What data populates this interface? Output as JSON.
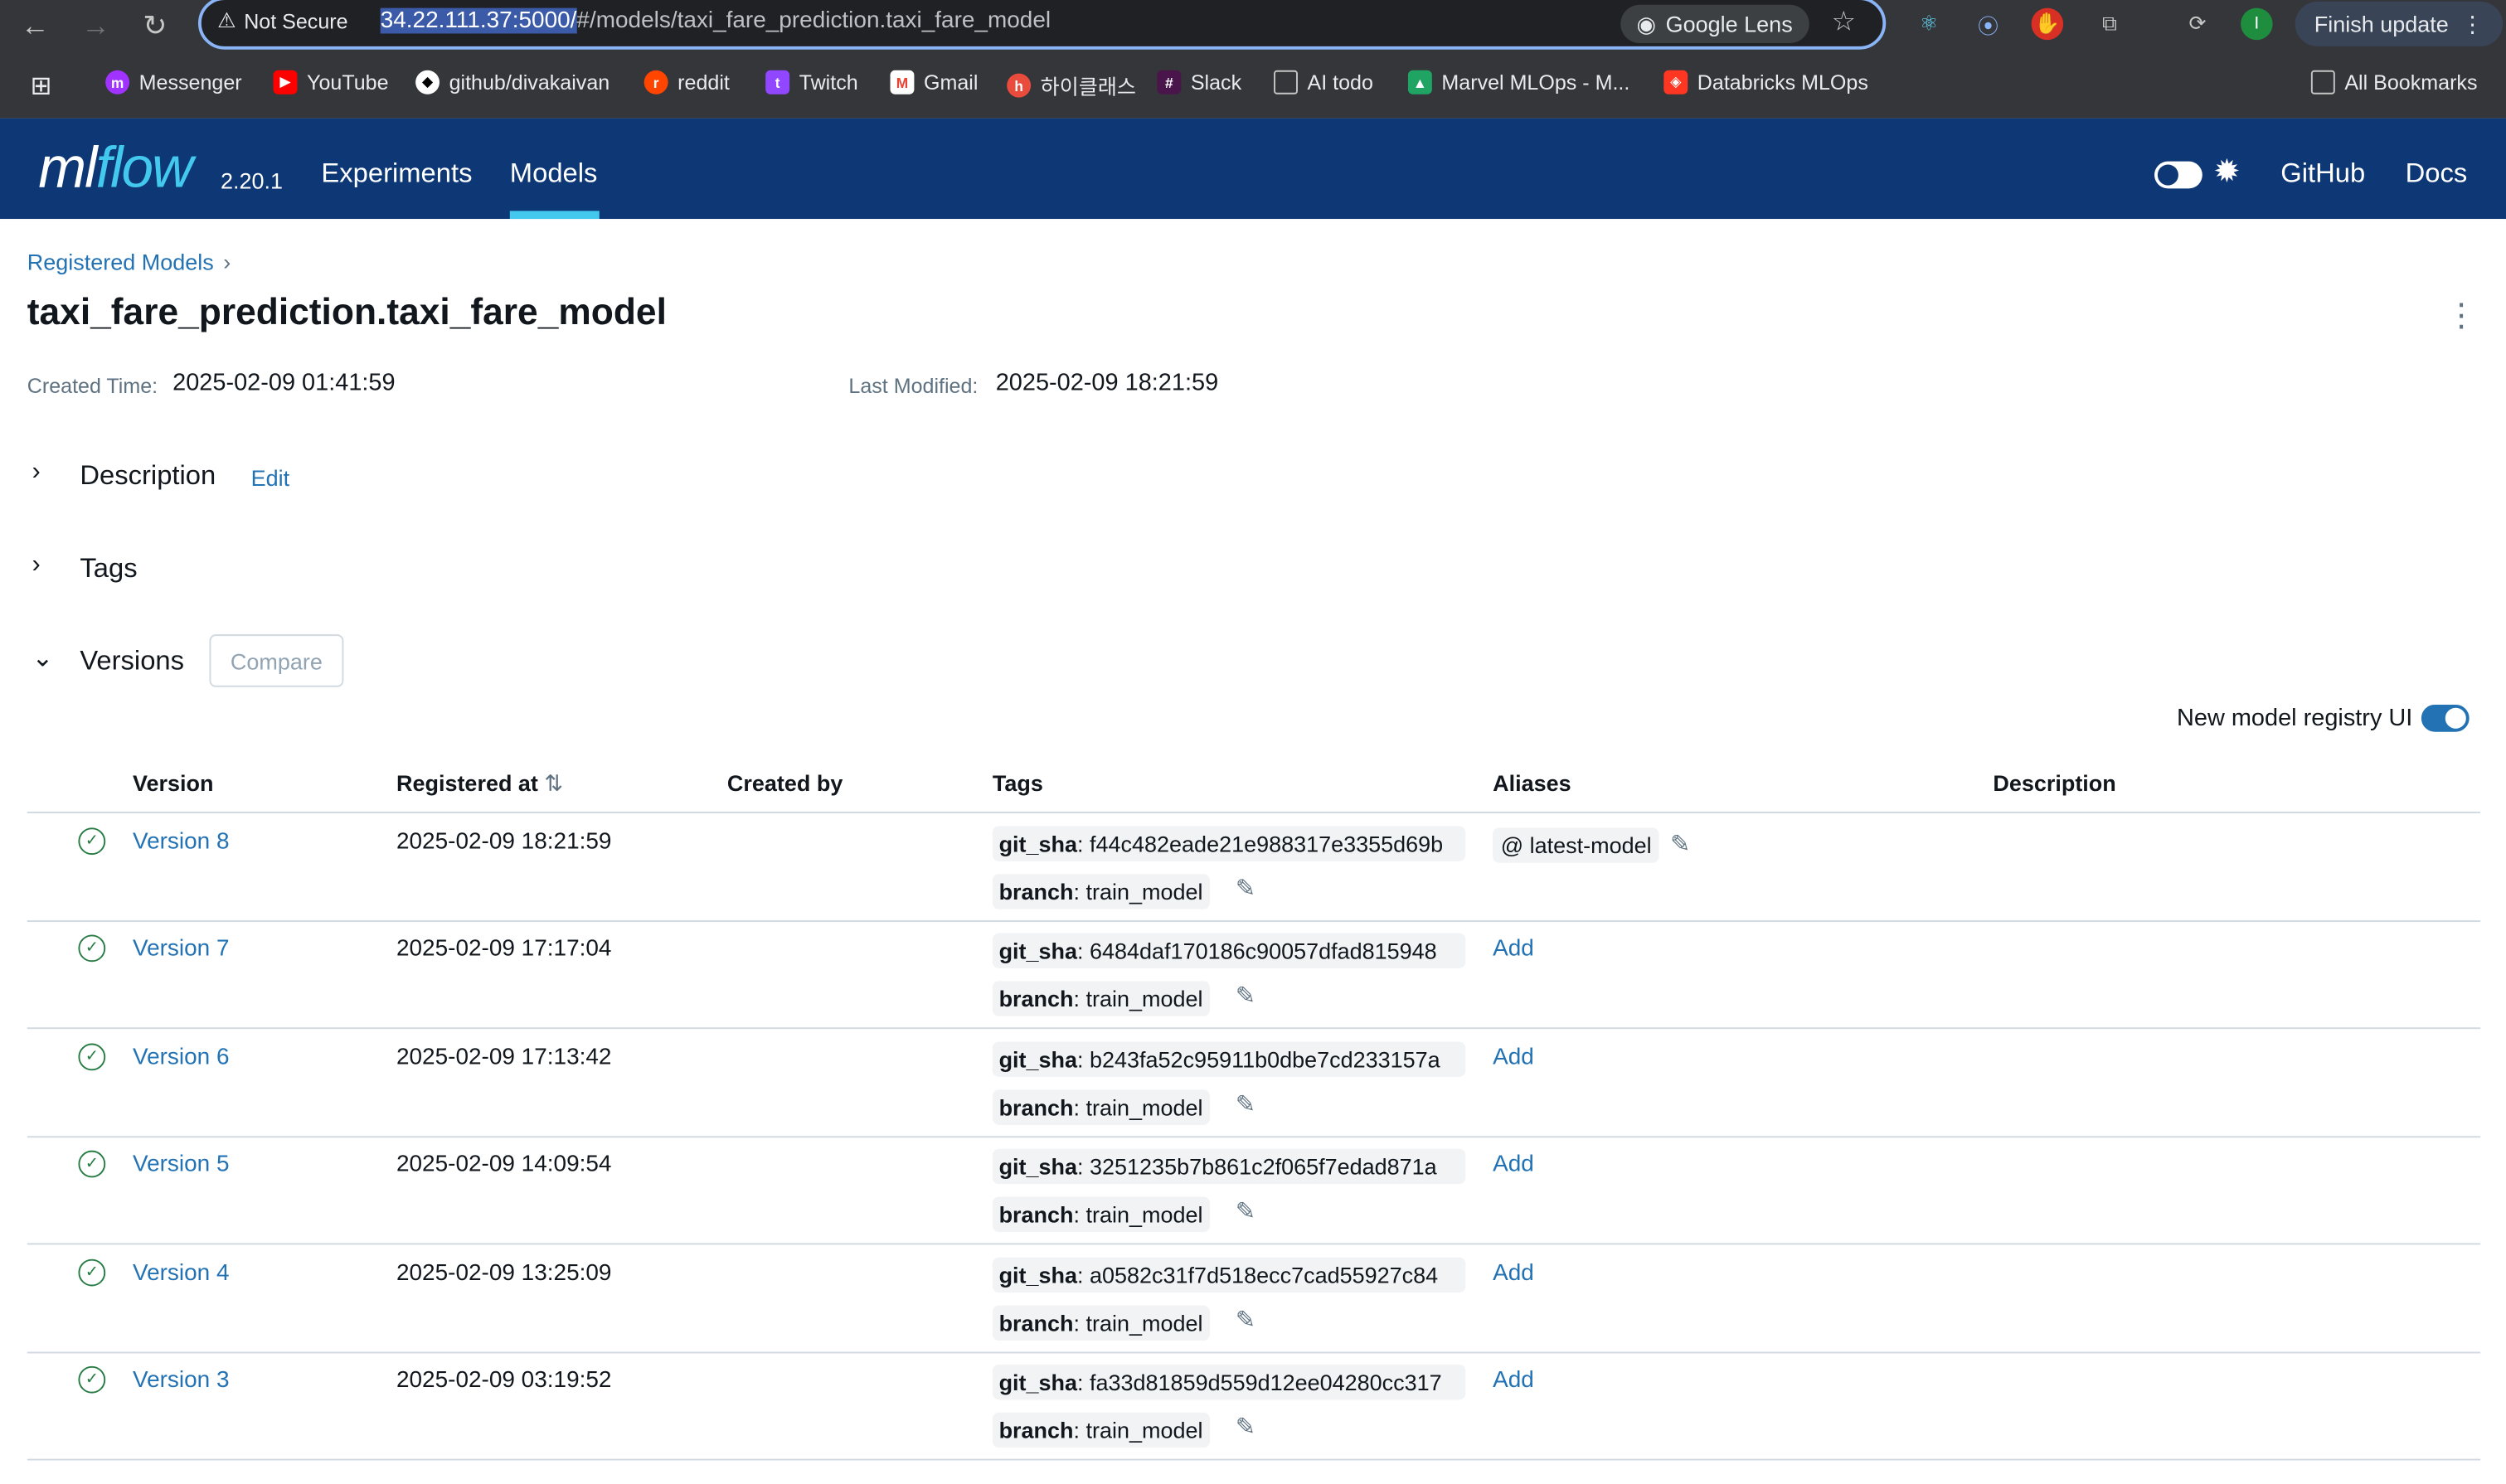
{
  "browser": {
    "security_label": "Not Secure",
    "url_host": "34.22.111.37:5000/",
    "url_path": "#/models/taxi_fare_prediction.taxi_fare_model",
    "lens_label": "Google Lens",
    "finish_update_label": "Finish update",
    "profile_initial": "I",
    "bookmarks": [
      "Messenger",
      "YouTube",
      "github/divakaivan",
      "reddit",
      "Twitch",
      "Gmail",
      "하이클래스",
      "Slack",
      "AI todo",
      "Marvel MLOps - M...",
      "Databricks MLOps"
    ],
    "all_bookmarks_label": "All Bookmarks"
  },
  "header": {
    "logo_ml": "ml",
    "logo_flow": "flow",
    "version": "2.20.1",
    "tabs": [
      "Experiments",
      "Models"
    ],
    "links": [
      "GitHub",
      "Docs"
    ]
  },
  "page": {
    "breadcrumb": "Registered Models",
    "title": "taxi_fare_prediction.taxi_fare_model",
    "created_label": "Created Time:",
    "created_value": "2025-02-09 01:41:59",
    "modified_label": "Last Modified:",
    "modified_value": "2025-02-09 18:21:59",
    "description_label": "Description",
    "edit_label": "Edit",
    "tags_label": "Tags",
    "versions_label": "Versions",
    "compare_label": "Compare",
    "new_ui_label": "New model registry UI"
  },
  "table": {
    "headers": [
      "Version",
      "Registered at",
      "Created by",
      "Tags",
      "Aliases",
      "Description"
    ],
    "rows": [
      {
        "version": "Version 8",
        "registered": "2025-02-09 18:21:59",
        "git_key": "git_sha",
        "git_val": "f44c482eade21e988317e3355d69b",
        "branch_key": "branch",
        "branch_val": "train_model",
        "alias": "@ latest-model",
        "add": ""
      },
      {
        "version": "Version 7",
        "registered": "2025-02-09 17:17:04",
        "git_key": "git_sha",
        "git_val": "6484daf170186c90057dfad815948",
        "branch_key": "branch",
        "branch_val": "train_model",
        "alias": "",
        "add": "Add"
      },
      {
        "version": "Version 6",
        "registered": "2025-02-09 17:13:42",
        "git_key": "git_sha",
        "git_val": "b243fa52c95911b0dbe7cd233157a",
        "branch_key": "branch",
        "branch_val": "train_model",
        "alias": "",
        "add": "Add"
      },
      {
        "version": "Version 5",
        "registered": "2025-02-09 14:09:54",
        "git_key": "git_sha",
        "git_val": "3251235b7b861c2f065f7edad871a",
        "branch_key": "branch",
        "branch_val": "train_model",
        "alias": "",
        "add": "Add"
      },
      {
        "version": "Version 4",
        "registered": "2025-02-09 13:25:09",
        "git_key": "git_sha",
        "git_val": "a0582c31f7d518ecc7cad55927c84",
        "branch_key": "branch",
        "branch_val": "train_model",
        "alias": "",
        "add": "Add"
      },
      {
        "version": "Version 3",
        "registered": "2025-02-09 03:19:52",
        "git_key": "git_sha",
        "git_val": "fa33d81859d559d12ee04280cc317",
        "branch_key": "branch",
        "branch_val": "train_model",
        "alias": "",
        "add": "Add"
      }
    ]
  }
}
